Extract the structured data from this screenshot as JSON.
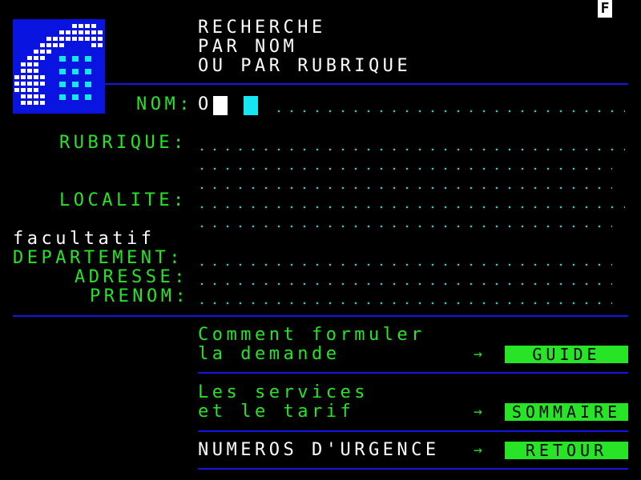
{
  "corner_flag": "F",
  "header": {
    "line1": "RECHERCHE",
    "line2": "PAR NOM",
    "line3": "OU PAR RUBRIQUE"
  },
  "form": {
    "nom_label": "NOM:",
    "nom_value": "O",
    "rubrique_label": "RUBRIQUE:",
    "localite_label": "LOCALITE:",
    "optional_label": "facultatif",
    "departement_label": "DEPARTEMENT:",
    "adresse_label": "ADRESSE:",
    "prenom_label": "PRENOM:"
  },
  "menu": {
    "guide_line1": "Comment formuler",
    "guide_line2": "la demande",
    "guide_arrow": "→",
    "guide_button": "GUIDE",
    "sommaire_line1": "Les services",
    "sommaire_line2": "et le tarif",
    "sommaire_arrow": "→",
    "sommaire_button": "SOMMAIRE",
    "urgence_label": "NUMEROS D'URGENCE",
    "urgence_arrow": "→",
    "retour_button": "RETOUR"
  },
  "colors": {
    "background": "#000000",
    "label_green": "#27e427",
    "header_white": "#ffffff",
    "dots_cyan": "#15d9e0",
    "separator_blue": "#1414e6",
    "logo_blue": "#0a14e0"
  },
  "icons": {
    "logo": "telephone-handset-logo"
  }
}
